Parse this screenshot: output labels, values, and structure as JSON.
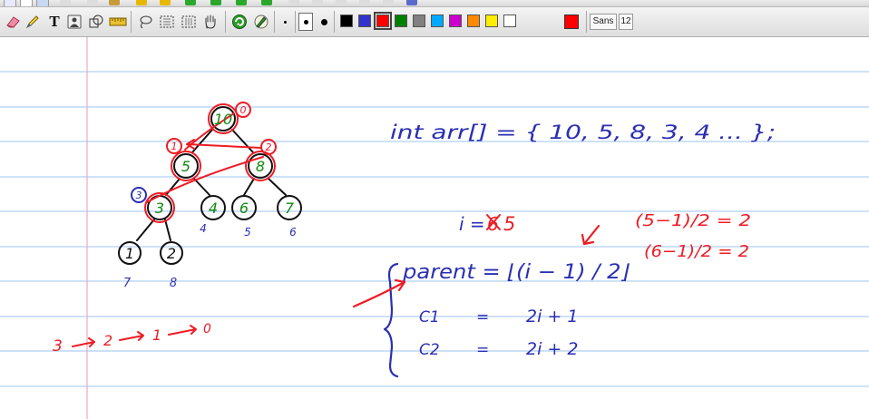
{
  "toolbar": {
    "icons": [
      "eraser-icon",
      "highlighter-icon",
      "text-icon",
      "image-icon",
      "shapes-icon",
      "ruler-icon",
      "lasso-icon",
      "select-rect-icon",
      "select-region-icon",
      "hand-icon",
      "autofill-icon",
      "shape-recognizer-icon"
    ],
    "thickness": [
      "thin",
      "medium",
      "thick"
    ],
    "selected_thickness": "medium",
    "colors": [
      "#000000",
      "#3333cc",
      "#ff0000",
      "#008000",
      "#808080",
      "#00aaff",
      "#cc00cc",
      "#ff8800",
      "#ffee00",
      "#ffffff"
    ],
    "selected_color": "#ff0000",
    "current_color": "#ff0000",
    "font_name": "Sans",
    "font_size": "12"
  },
  "page": {
    "background": "ruled-paper",
    "rule_color": "#9cc3f0",
    "margin_color": "#f0a6c8"
  },
  "ink": {
    "blue": "#2a2fb3",
    "green": "#108a10",
    "red": "#ee1c24",
    "black": "#111111"
  },
  "notes": {
    "tree_nodes": [
      "10",
      "5",
      "8",
      "3",
      "4",
      "6",
      "7",
      "1",
      "2"
    ],
    "tree_index_labels": [
      "0",
      "1",
      "2",
      "3",
      "4",
      "5",
      "6",
      "7",
      "8"
    ],
    "array_decl": "int arr[] = { 10, 5, 8, 3, 4 ... };",
    "i_label": "i =",
    "i_old_value": "6",
    "i_value": "5",
    "parent_formula": "parent = ⌊(i − 1) / 2⌋",
    "c1_label": "C1",
    "c1_formula": "2i + 1",
    "c2_label": "C2",
    "c2_formula": "2i + 2",
    "equals": "=",
    "calc1": "(5−1)/2 = 2",
    "calc2": "(6−1)/2 = 2",
    "chain": [
      "3",
      "2",
      "1",
      "0"
    ]
  }
}
